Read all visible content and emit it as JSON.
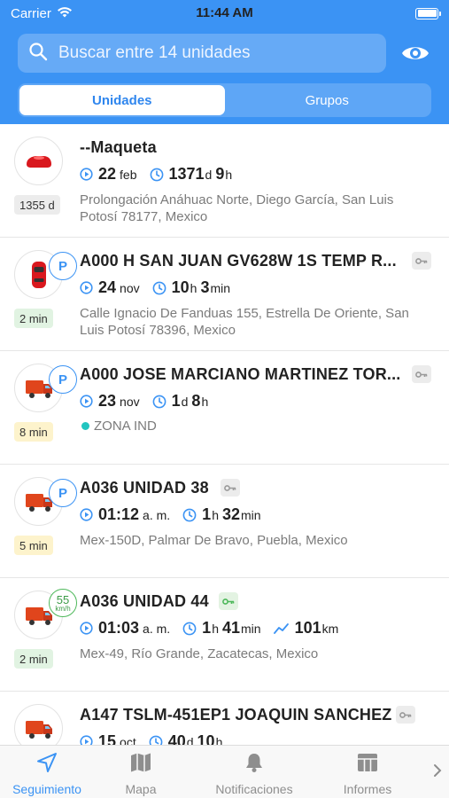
{
  "status": {
    "carrier": "Carrier",
    "time": "11:44 AM"
  },
  "search": {
    "placeholder": "Buscar entre 14 unidades"
  },
  "segments": [
    {
      "label": "Unidades",
      "active": true
    },
    {
      "label": "Grupos",
      "active": false
    }
  ],
  "units": [
    {
      "title": "--Maqueta",
      "age": "1355 d",
      "age_color": "gray",
      "icon": "red-car-icon",
      "m1_big": "22",
      "m1_small": "feb",
      "m2_big": "1371",
      "m2_small1": "d",
      "m2_big2": "9",
      "m2_small2": "h",
      "address": "Prolongación Anáhuac Norte, Diego García, San Luis Potosí 78177, Mexico"
    },
    {
      "title": "A000 H SAN JUAN GV628W 1S TEMP R...",
      "age": "2 min",
      "age_color": "green",
      "icon": "red-car-top-icon",
      "m1_big": "24",
      "m1_small": "nov",
      "m2_big": "10",
      "m2_small1": "h",
      "m2_big2": "3",
      "m2_small2": "min",
      "address": "Calle Ignacio De Fanduas 155, Estrella De Oriente, San Luis Potosí 78396, Mexico"
    },
    {
      "title": "A000 JOSE MARCIANO MARTINEZ TOR...",
      "age": "8 min",
      "age_color": "yellow",
      "icon": "truck-icon",
      "m1_big": "23",
      "m1_small": "nov",
      "m2_big": "1",
      "m2_small1": "d",
      "m2_big2": "8",
      "m2_small2": "h",
      "zone": "ZONA IND"
    },
    {
      "title": "A036 UNIDAD 38",
      "age": "5 min",
      "age_color": "yellow",
      "icon": "truck-icon",
      "m1_big": "01:12",
      "m1_small": "a. m.",
      "m2_big": "1",
      "m2_small1": "h",
      "m2_big2": "32",
      "m2_small2": "min",
      "address": "Mex-150D, Palmar De Bravo, Puebla, Mexico"
    },
    {
      "title": "A036 UNIDAD 44",
      "age": "2 min",
      "age_color": "green",
      "icon": "truck-icon",
      "speed": "55",
      "speed_unit": "km/h",
      "m1_big": "01:03",
      "m1_small": "a. m.",
      "m2_big": "1",
      "m2_small1": "h",
      "m2_big2": "41",
      "m2_small2": "min",
      "m3_big": "101",
      "m3_small": "km",
      "address": "Mex-49, Río Grande, Zacatecas, Mexico"
    },
    {
      "title": "A147 TSLM-451EP1 JOAQUIN SANCHEZ",
      "icon": "truck-icon",
      "m1_big": "15",
      "m1_small": "oct",
      "m2_big": "40",
      "m2_small1": "d",
      "m2_big2": "10",
      "m2_small2": "h"
    }
  ],
  "tabs": [
    {
      "label": "Seguimiento",
      "icon": "navigation-arrow-icon",
      "active": true
    },
    {
      "label": "Mapa",
      "icon": "map-icon"
    },
    {
      "label": "Notificaciones",
      "icon": "bell-icon"
    },
    {
      "label": "Informes",
      "icon": "table-icon"
    }
  ],
  "colors": {
    "primary": "#3b93f4",
    "speed_green": "#4db85a",
    "zone_dot": "#22c5c0"
  }
}
